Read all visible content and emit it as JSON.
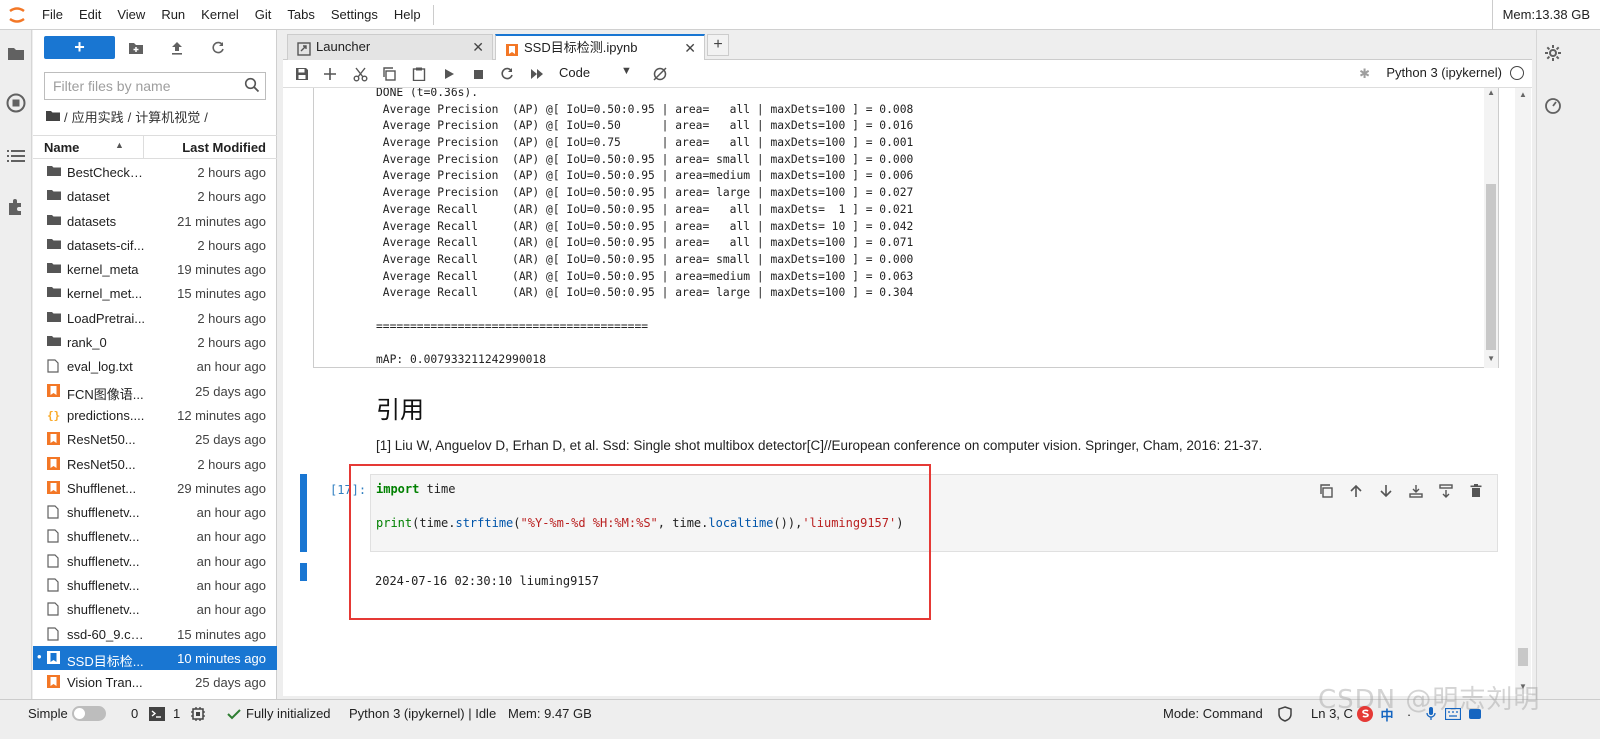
{
  "menubar": {
    "items": [
      "File",
      "Edit",
      "View",
      "Run",
      "Kernel",
      "Git",
      "Tabs",
      "Settings",
      "Help"
    ],
    "memory": "Mem:13.38 GB"
  },
  "left_bar": {
    "icons": [
      "folder-icon",
      "running-icon",
      "toc-icon",
      "extension-icon"
    ]
  },
  "filebrowser": {
    "new_label": "+",
    "filter_placeholder": "Filter files by name",
    "breadcrumb": [
      "/",
      "应用实践",
      "/",
      "计算机视觉",
      "/"
    ],
    "columns": {
      "name": "Name",
      "modified": "Last Modified"
    },
    "files": [
      {
        "name": "BestCheckp...",
        "modified": "2 hours ago",
        "type": "folder"
      },
      {
        "name": "dataset",
        "modified": "2 hours ago",
        "type": "folder"
      },
      {
        "name": "datasets",
        "modified": "21 minutes ago",
        "type": "folder"
      },
      {
        "name": "datasets-cif...",
        "modified": "2 hours ago",
        "type": "folder"
      },
      {
        "name": "kernel_meta",
        "modified": "19 minutes ago",
        "type": "folder"
      },
      {
        "name": "kernel_met...",
        "modified": "15 minutes ago",
        "type": "folder"
      },
      {
        "name": "LoadPretrai...",
        "modified": "2 hours ago",
        "type": "folder"
      },
      {
        "name": "rank_0",
        "modified": "2 hours ago",
        "type": "folder"
      },
      {
        "name": "eval_log.txt",
        "modified": "an hour ago",
        "type": "file"
      },
      {
        "name": "FCN图像语...",
        "modified": "25 days ago",
        "type": "notebook"
      },
      {
        "name": "predictions....",
        "modified": "12 minutes ago",
        "type": "json"
      },
      {
        "name": "ResNet50...",
        "modified": "25 days ago",
        "type": "notebook"
      },
      {
        "name": "ResNet50...",
        "modified": "2 hours ago",
        "type": "notebook"
      },
      {
        "name": "Shufflenet...",
        "modified": "29 minutes ago",
        "type": "notebook"
      },
      {
        "name": "shufflenetv...",
        "modified": "an hour ago",
        "type": "file"
      },
      {
        "name": "shufflenetv...",
        "modified": "an hour ago",
        "type": "file"
      },
      {
        "name": "shufflenetv...",
        "modified": "an hour ago",
        "type": "file"
      },
      {
        "name": "shufflenetv...",
        "modified": "an hour ago",
        "type": "file"
      },
      {
        "name": "shufflenetv...",
        "modified": "an hour ago",
        "type": "file"
      },
      {
        "name": "ssd-60_9.ck...",
        "modified": "15 minutes ago",
        "type": "file"
      },
      {
        "name": "SSD目标检...",
        "modified": "10 minutes ago",
        "type": "notebook",
        "selected": true
      },
      {
        "name": "Vision Tran...",
        "modified": "25 days ago",
        "type": "notebook"
      }
    ]
  },
  "tabs": [
    {
      "label": "Launcher",
      "close": "✕"
    },
    {
      "label": "SSD目标检测.ipynb",
      "close": "✕"
    }
  ],
  "tab_add": "+",
  "notebook_toolbar": {
    "cell_type": "Code",
    "kernel": "Python 3 (ipykernel)"
  },
  "output_lines": [
    "DONE (t=0.36s).",
    " Average Precision  (AP) @[ IoU=0.50:0.95 | area=   all | maxDets=100 ] = 0.008",
    " Average Precision  (AP) @[ IoU=0.50      | area=   all | maxDets=100 ] = 0.016",
    " Average Precision  (AP) @[ IoU=0.75      | area=   all | maxDets=100 ] = 0.001",
    " Average Precision  (AP) @[ IoU=0.50:0.95 | area= small | maxDets=100 ] = 0.000",
    " Average Precision  (AP) @[ IoU=0.50:0.95 | area=medium | maxDets=100 ] = 0.006",
    " Average Precision  (AP) @[ IoU=0.50:0.95 | area= large | maxDets=100 ] = 0.027",
    " Average Recall     (AR) @[ IoU=0.50:0.95 | area=   all | maxDets=  1 ] = 0.021",
    " Average Recall     (AR) @[ IoU=0.50:0.95 | area=   all | maxDets= 10 ] = 0.042",
    " Average Recall     (AR) @[ IoU=0.50:0.95 | area=   all | maxDets=100 ] = 0.071",
    " Average Recall     (AR) @[ IoU=0.50:0.95 | area= small | maxDets=100 ] = 0.000",
    " Average Recall     (AR) @[ IoU=0.50:0.95 | area=medium | maxDets=100 ] = 0.063",
    " Average Recall     (AR) @[ IoU=0.50:0.95 | area= large | maxDets=100 ] = 0.304",
    "",
    "========================================",
    "",
    "mAP: 0.007933211242990018"
  ],
  "markdown": {
    "heading": "引用",
    "citation": "[1] Liu W, Anguelov D, Erhan D, et al. Ssd: Single shot multibox detector[C]//European conference on computer vision. Springer, Cham, 2016: 21-37."
  },
  "code_cell": {
    "prompt": "[17]:",
    "line1_kw": "import",
    "line1_rest": " time",
    "line2_print": "print",
    "line2_open": "(time.",
    "line2_fn1": "strftime",
    "line2_str1": "\"%Y-%m-%d %H:%M:%S\"",
    "line2_mid": ", time.",
    "line2_fn2": "localtime",
    "line2_str2": "'liuming9157'",
    "output": "2024-07-16 02:30:10 liuming9157"
  },
  "right_bar": {
    "icons": [
      "gear-icon",
      "debugger-icon"
    ]
  },
  "statusbar": {
    "mode": "Simple",
    "terminals": "0",
    "kernels": "1",
    "fully_initialized": "Fully initialized",
    "kernel_status": "Python 3 (ipykernel) | Idle",
    "memory": "Mem: 9.47 GB",
    "command_mode": "Mode: Command",
    "position": "Ln 3, C"
  },
  "watermark": "CSDN @明志刘明",
  "ime": [
    "中"
  ]
}
